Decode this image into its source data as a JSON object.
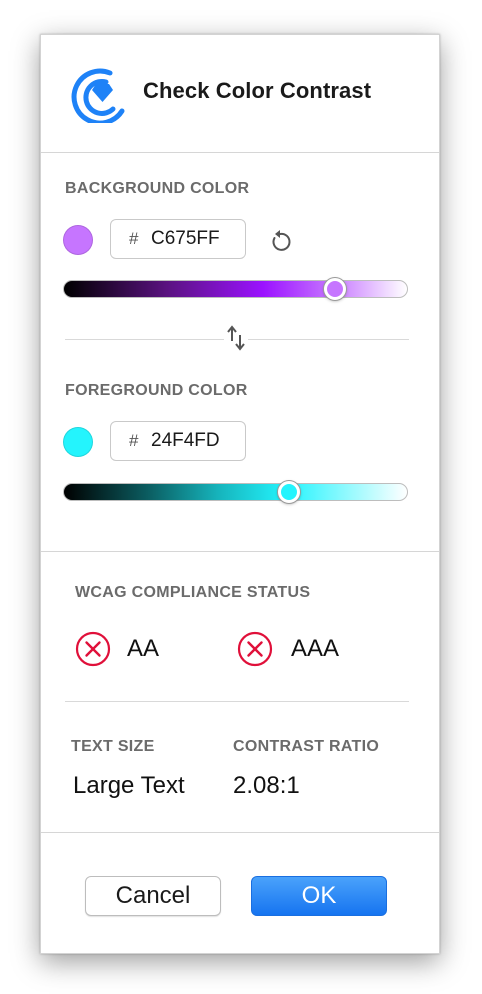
{
  "dialog": {
    "title": "Check Color Contrast"
  },
  "background": {
    "label": "BACKGROUND COLOR",
    "hash": "#",
    "hex": "C675FF",
    "swatch_color": "#C675FF",
    "slider_value": 0.8
  },
  "foreground": {
    "label": "FOREGROUND COLOR",
    "hash": "#",
    "hex": "24F4FD",
    "swatch_color": "#24F4FD",
    "slider_value": 0.66
  },
  "compliance": {
    "label": "WCAG COMPLIANCE STATUS",
    "items": [
      {
        "level": "AA",
        "status": "fail"
      },
      {
        "level": "AAA",
        "status": "fail"
      }
    ],
    "fail_color": "#E0103A"
  },
  "info": {
    "text_size_label": "TEXT SIZE",
    "text_size_value": "Large Text",
    "ratio_label": "CONTRAST RATIO",
    "ratio_value": "2.08:1"
  },
  "buttons": {
    "cancel": "Cancel",
    "ok": "OK"
  },
  "colors": {
    "accent": "#1E82F7"
  },
  "icons": {
    "logo": "contrast-logo-icon",
    "reset": "reset-icon",
    "swap": "swap-icon",
    "fail": "x-circle-icon"
  }
}
